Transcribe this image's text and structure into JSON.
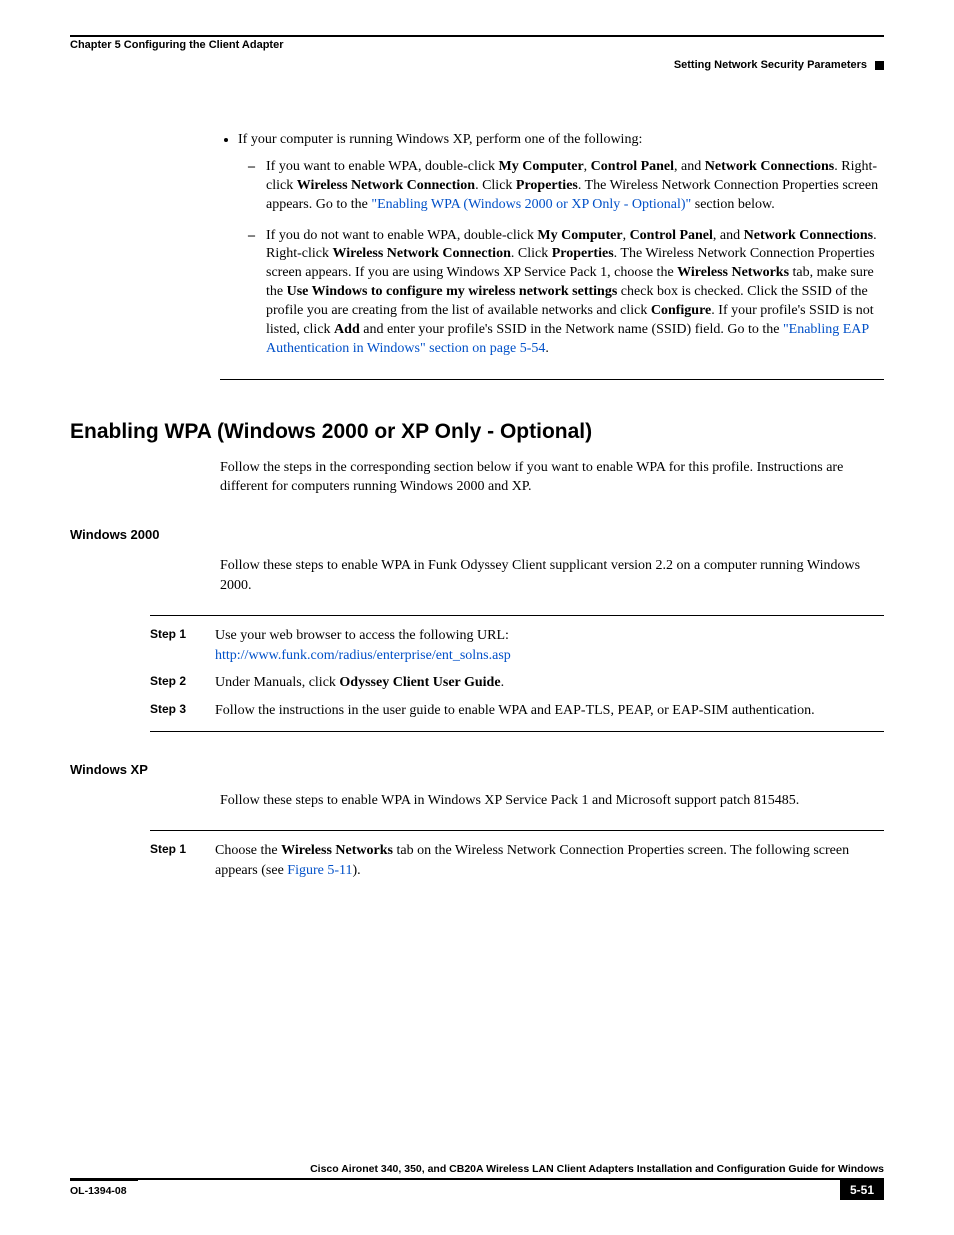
{
  "header": {
    "chapter": "Chapter 5      Configuring the Client Adapter",
    "section": "Setting Network Security Parameters"
  },
  "bullets": {
    "xp_intro": "If your computer is running Windows XP, perform one of the following:",
    "wpa_enable_pre": "If you want to enable WPA, double-click ",
    "mycomp": "My Computer",
    "cpanel": "Control Panel",
    "and": ", and ",
    "netconn": "Network Connections",
    "rclick": ". Right-click ",
    "wnc": "Wireless Network Connection",
    "clickprop": ". Click ",
    "properties": "Properties",
    "sentence_a_tail": ". The Wireless Network Connection Properties screen appears. Go to the ",
    "link_a": "\"Enabling WPA (Windows 2000 or XP Only - Optional)\"",
    "link_a_tail": " section below.",
    "nowpa_pre": "If you do not want to enable WPA, double-click ",
    "sentence_b_mid": ". The Wireless Network Connection Properties screen appears. If you are using Windows XP Service Pack 1, choose the ",
    "wntab": "Wireless Networks",
    "sentence_b_mid2": " tab, make sure the ",
    "usewin": "Use Windows to configure my wireless network settings",
    "sentence_b_mid3": " check box is checked. Click the SSID of the profile you are creating from the list of available networks and click ",
    "configure": "Configure",
    "sentence_b_mid4": ". If your profile's SSID is not listed, click ",
    "add": "Add",
    "sentence_b_mid5": " and enter your profile's SSID in the Network name (SSID) field. Go to the ",
    "link_b": "\"Enabling EAP Authentication in Windows\" section on page 5-54",
    "period": "."
  },
  "section_title": "Enabling WPA (Windows 2000 or XP Only - Optional)",
  "section_intro": "Follow the steps in the corresponding section below if you want to enable WPA for this profile. Instructions are different for computers running Windows 2000 and XP.",
  "win2000": {
    "title": "Windows 2000",
    "intro": "Follow these steps to enable WPA in Funk Odyssey Client supplicant version 2.2 on a computer running Windows 2000.",
    "step1_label": "Step 1",
    "step1_text": "Use your web browser to access the following URL:",
    "step1_url": "http://www.funk.com/radius/enterprise/ent_solns.asp",
    "step2_label": "Step 2",
    "step2_pre": "Under Manuals, click ",
    "step2_bold": "Odyssey Client User Guide",
    "step3_label": "Step 3",
    "step3_text": "Follow the instructions in the user guide to enable WPA and EAP-TLS, PEAP, or EAP-SIM authentication."
  },
  "winxp": {
    "title": "Windows XP",
    "intro": "Follow these steps to enable WPA in Windows XP Service Pack 1 and Microsoft support patch 815485.",
    "step1_label": "Step 1",
    "step1_pre": "Choose the ",
    "step1_bold": "Wireless Networks",
    "step1_mid": " tab on the Wireless Network Connection Properties screen. The following screen appears (see ",
    "step1_link": "Figure 5-11",
    "step1_tail": ")."
  },
  "footer": {
    "guide": "Cisco Aironet 340, 350, and CB20A Wireless LAN Client Adapters Installation and Configuration Guide for Windows",
    "doc": "OL-1394-08",
    "page": "5-51"
  }
}
